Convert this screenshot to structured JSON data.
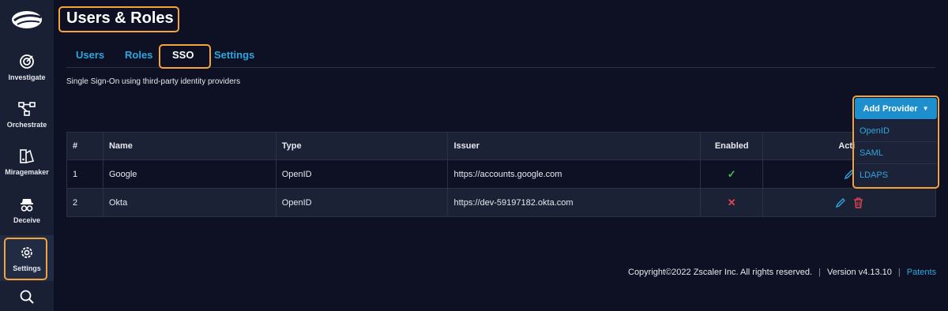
{
  "sidebar": {
    "items": [
      {
        "label": "Investigate",
        "icon": "investigate-icon"
      },
      {
        "label": "Orchestrate",
        "icon": "orchestrate-icon"
      },
      {
        "label": "Miragemaker",
        "icon": "miragemaker-icon"
      },
      {
        "label": "Deceive",
        "icon": "deceive-icon"
      },
      {
        "label": "Settings",
        "icon": "gear-icon",
        "active": true
      },
      {
        "label": "",
        "icon": "search-icon"
      }
    ]
  },
  "page": {
    "title": "Users & Roles",
    "subtitle": "Single Sign-On using third-party identity providers"
  },
  "tabs": [
    {
      "label": "Users"
    },
    {
      "label": "Roles"
    },
    {
      "label": "SSO",
      "active": true
    },
    {
      "label": "Settings"
    }
  ],
  "add_provider": {
    "label": "Add Provider",
    "options": [
      "OpenID",
      "SAML",
      "LDAPS"
    ]
  },
  "table": {
    "columns": [
      "#",
      "Name",
      "Type",
      "Issuer",
      "Enabled",
      "Actio"
    ],
    "rows": [
      {
        "num": "1",
        "name": "Google",
        "type": "OpenID",
        "issuer": "https://accounts.google.com",
        "enabled": true,
        "enabled_symbol": "✓"
      },
      {
        "num": "2",
        "name": "Okta",
        "type": "OpenID",
        "issuer": "https://dev-59197182.okta.com",
        "enabled": false,
        "enabled_symbol": "✕"
      }
    ]
  },
  "footer": {
    "copyright": "Copyright©2022 Zscaler Inc. All rights reserved.",
    "version": "Version v4.13.10",
    "patents": "Patents"
  },
  "colors": {
    "background": "#0d1123",
    "sidebar": "#1a2033",
    "accent": "#2fa6de",
    "button": "#1d8fce",
    "highlight": "#f5a33b",
    "enabled_true": "#3fbf52",
    "enabled_false": "#e04453"
  }
}
